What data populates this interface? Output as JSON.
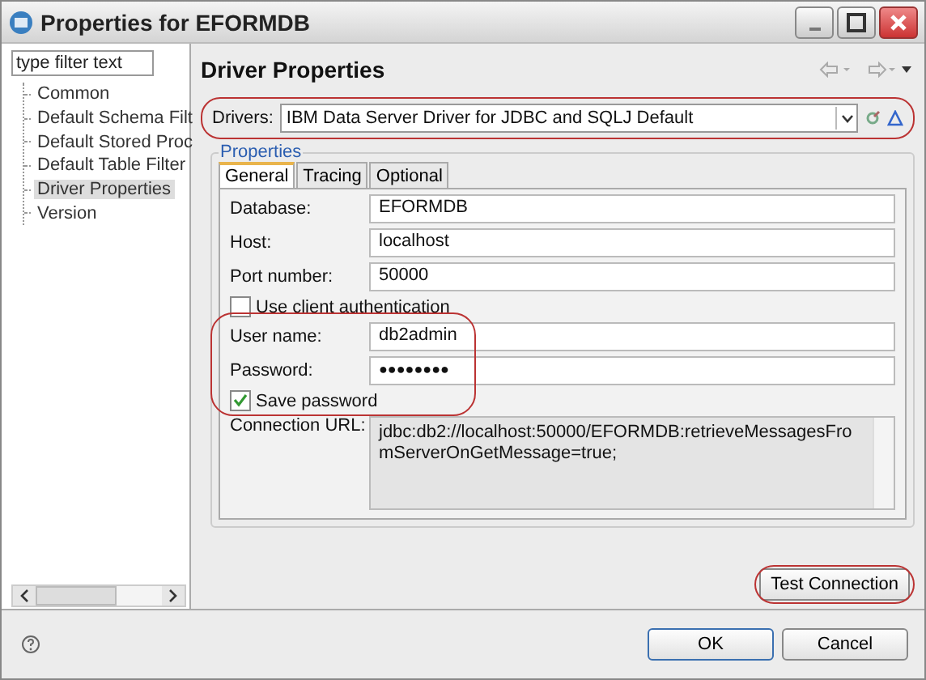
{
  "window": {
    "title": "Properties for EFORMDB"
  },
  "sidebar": {
    "filter": {
      "placeholder": "type filter text"
    },
    "items": [
      {
        "label": "Common",
        "selected": false
      },
      {
        "label": "Default Schema Filt",
        "selected": false
      },
      {
        "label": "Default Stored Proc",
        "selected": false
      },
      {
        "label": "Default Table Filter",
        "selected": false
      },
      {
        "label": "Driver Properties",
        "selected": true
      },
      {
        "label": "Version",
        "selected": false
      }
    ]
  },
  "page": {
    "title": "Driver Properties",
    "drivers": {
      "label": "Drivers:",
      "value": "IBM Data Server Driver for JDBC and SQLJ Default",
      "highlighted": true
    },
    "group": {
      "title": "Properties",
      "tabs": [
        {
          "label": "General",
          "selected": true
        },
        {
          "label": "Tracing",
          "selected": false
        },
        {
          "label": "Optional",
          "selected": false
        }
      ],
      "fields": [
        {
          "label": "Database:",
          "value": "EFORMDB"
        },
        {
          "label": "Host:",
          "value": "localhost"
        },
        {
          "label": "Port number:",
          "value": "50000"
        }
      ],
      "client_auth": {
        "label": "Use client authentication",
        "checked": false
      },
      "credentials": {
        "highlighted": true,
        "fields": [
          {
            "label": "User name:",
            "value": "db2admin"
          },
          {
            "label": "Password:",
            "value": "●●●●●●●●"
          }
        ],
        "save_password": {
          "label": "Save password",
          "checked": true
        }
      },
      "connection_url": {
        "label": "Connection URL:",
        "value": "jdbc:db2://localhost:50000/EFORMDB:retrieveMessagesFromServerOnGetMessage=true;"
      }
    },
    "test_button": {
      "label": "Test Connection",
      "highlighted": true
    }
  },
  "buttons": [
    "OK",
    "Cancel"
  ]
}
